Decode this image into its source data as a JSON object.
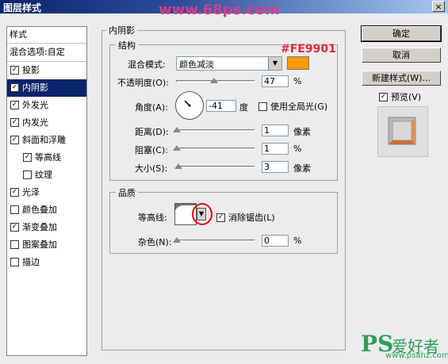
{
  "window": {
    "title": "图层样式",
    "close_label": "×"
  },
  "watermarks": {
    "top": "www.68ps.com",
    "bottom_logo": "PS",
    "bottom_text": "爱好者",
    "bottom_url": "www.psahz.com"
  },
  "style_list": {
    "header": "样式",
    "blend_options": "混合选项:自定",
    "items": [
      {
        "label": "投影",
        "checked": true,
        "indent": false,
        "selected": false
      },
      {
        "label": "内阴影",
        "checked": true,
        "indent": false,
        "selected": true
      },
      {
        "label": "外发光",
        "checked": true,
        "indent": false,
        "selected": false
      },
      {
        "label": "内发光",
        "checked": true,
        "indent": false,
        "selected": false
      },
      {
        "label": "斜面和浮雕",
        "checked": true,
        "indent": false,
        "selected": false
      },
      {
        "label": "等高线",
        "checked": true,
        "indent": true,
        "selected": false
      },
      {
        "label": "纹理",
        "checked": false,
        "indent": true,
        "selected": false
      },
      {
        "label": "光泽",
        "checked": true,
        "indent": false,
        "selected": false
      },
      {
        "label": "颜色叠加",
        "checked": false,
        "indent": false,
        "selected": false
      },
      {
        "label": "渐变叠加",
        "checked": true,
        "indent": false,
        "selected": false
      },
      {
        "label": "图案叠加",
        "checked": false,
        "indent": false,
        "selected": false
      },
      {
        "label": "描边",
        "checked": false,
        "indent": false,
        "selected": false
      }
    ]
  },
  "inner_shadow": {
    "section_title": "内阴影",
    "structure": {
      "title": "结构",
      "blend_mode_label": "混合模式:",
      "blend_mode_value": "颜色减淡",
      "color_annotation": "#FE9901",
      "swatch_color": "#FE9901",
      "opacity_label": "不透明度(O):",
      "opacity_value": "47",
      "opacity_unit": "%",
      "opacity_fraction": 0.47,
      "angle_label": "角度(A):",
      "angle_value": "-41",
      "angle_unit": "度",
      "global_light_label": "使用全局光(G)",
      "global_light_checked": false,
      "distance_label": "距离(D):",
      "distance_value": "1",
      "distance_unit": "像素",
      "choke_label": "阻塞(C):",
      "choke_value": "1",
      "choke_unit": "%",
      "size_label": "大小(S):",
      "size_value": "3",
      "size_unit": "像素"
    },
    "quality": {
      "title": "品质",
      "contour_label": "等高线:",
      "antialias_label": "消除锯齿(L)",
      "antialias_checked": true,
      "noise_label": "杂色(N):",
      "noise_value": "0",
      "noise_unit": "%"
    }
  },
  "buttons": {
    "ok": "确定",
    "cancel": "取消",
    "new_style": "新建样式(W)...",
    "preview_label": "预览(V)",
    "preview_checked": true
  },
  "colors": {
    "selection": "#0a246a",
    "annotation_red": "#e8233a",
    "swatch": "#FE9901"
  }
}
